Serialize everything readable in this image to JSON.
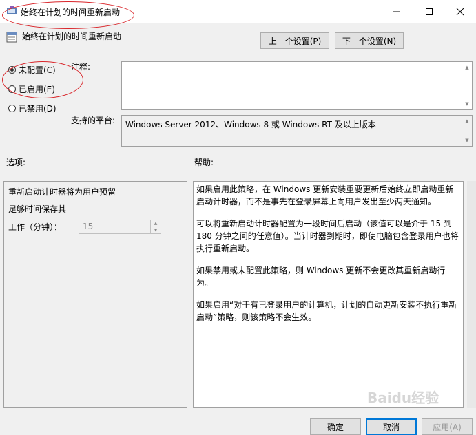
{
  "window": {
    "title": "始终在计划的时间重新启动"
  },
  "header": {
    "policy_name": "始终在计划的时间重新启动",
    "prev_button": "上一个设置(P)",
    "next_button": "下一个设置(N)"
  },
  "state": {
    "not_configured": "未配置(C)",
    "enabled": "已启用(E)",
    "disabled": "已禁用(D)",
    "selected": "not_configured"
  },
  "comment": {
    "label": "注释:",
    "value": ""
  },
  "platform": {
    "label": "支持的平台:",
    "value": "Windows Server 2012、Windows 8 或 Windows RT 及以上版本"
  },
  "options": {
    "label": "选项:",
    "line1": "重新启动计时器将为用户预留",
    "line2": "足够时间保存其",
    "work_label": "工作（分钟）：",
    "work_value": "15"
  },
  "help": {
    "label": "帮助:",
    "paragraphs": [
      "如果启用此策略，在 Windows 更新安装重要更新后始终立即启动重新启动计时器，而不是事先在登录屏幕上向用户发出至少两天通知。",
      "可以将重新启动计时器配置为一段时间后启动（该值可以是介于 15 到 180 分钟之间的任意值）。当计时器到期时，即使电脑包含登录用户也将执行重新启动。",
      "如果禁用或未配置此策略，则 Windows 更新不会更改其重新启动行为。",
      "如果启用“对于有已登录用户的计算机，计划的自动更新安装不执行重新启动”策略，则该策略不会生效。"
    ]
  },
  "footer": {
    "ok": "确定",
    "cancel": "取消",
    "apply": "应用(A)"
  },
  "watermark": {
    "brand": "Baidu经验"
  },
  "colors": {
    "annotation_red": "#d9262b",
    "button_bg": "#e1e1e1",
    "dialog_bg": "#f0f0f0"
  }
}
